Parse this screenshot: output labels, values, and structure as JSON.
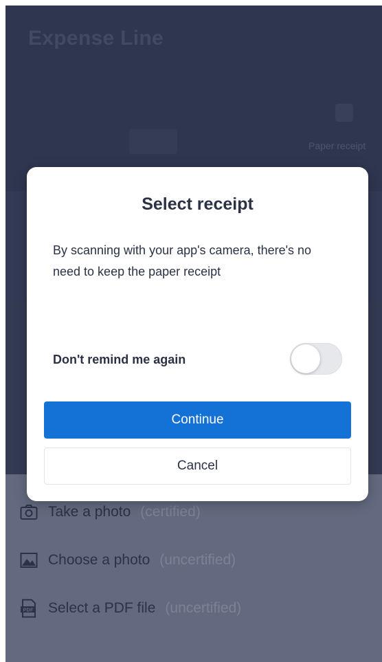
{
  "background": {
    "title": "Expense Line",
    "tab_label": "Paper receipt"
  },
  "action_sheet": {
    "items": [
      {
        "label": "Take a photo",
        "note": "(certified)",
        "icon": "camera-icon"
      },
      {
        "label": "Choose a photo",
        "note": "(uncertified)",
        "icon": "image-icon"
      },
      {
        "label": "Select a PDF file",
        "note": "(uncertified)",
        "icon": "pdf-icon",
        "icon_text": "PDF"
      }
    ]
  },
  "dialog": {
    "title": "Select receipt",
    "message": "By scanning with your app's camera, there's no need to keep the paper receipt",
    "remind_label": "Don't remind me again",
    "remind_toggle_on": false,
    "continue_label": "Continue",
    "cancel_label": "Cancel"
  },
  "colors": {
    "primary": "#1472d6",
    "overlay": "#323a52",
    "sheet": "#636a80"
  }
}
